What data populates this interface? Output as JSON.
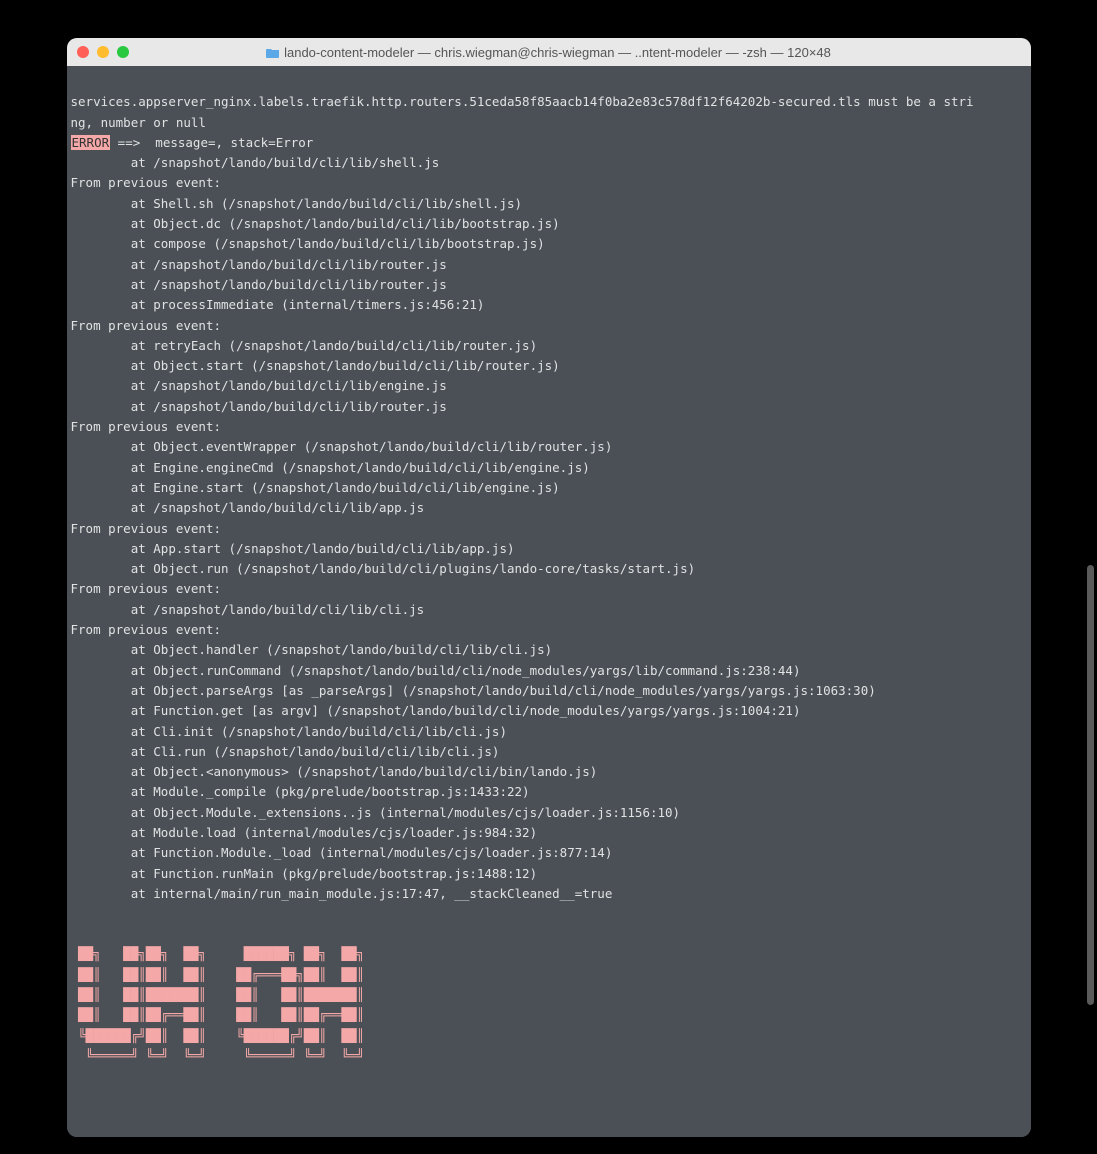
{
  "window": {
    "title": "lando-content-modeler — chris.wiegman@chris-wiegman — ..ntent-modeler — -zsh — 120×48"
  },
  "terminal": {
    "line1": "services.appserver_nginx.labels.traefik.http.routers.51ceda58f85aacb14f0ba2e83c578df12f64202b-secured.tls must be a stri",
    "line2": "ng, number or null",
    "error_label": "ERROR",
    "error_rest": " ==>  message=, stack=Error",
    "stack": [
      "        at /snapshot/lando/build/cli/lib/shell.js",
      "From previous event:",
      "        at Shell.sh (/snapshot/lando/build/cli/lib/shell.js)",
      "        at Object.dc (/snapshot/lando/build/cli/lib/bootstrap.js)",
      "        at compose (/snapshot/lando/build/cli/lib/bootstrap.js)",
      "        at /snapshot/lando/build/cli/lib/router.js",
      "        at /snapshot/lando/build/cli/lib/router.js",
      "        at processImmediate (internal/timers.js:456:21)",
      "From previous event:",
      "        at retryEach (/snapshot/lando/build/cli/lib/router.js)",
      "        at Object.start (/snapshot/lando/build/cli/lib/router.js)",
      "        at /snapshot/lando/build/cli/lib/engine.js",
      "        at /snapshot/lando/build/cli/lib/router.js",
      "From previous event:",
      "        at Object.eventWrapper (/snapshot/lando/build/cli/lib/router.js)",
      "        at Engine.engineCmd (/snapshot/lando/build/cli/lib/engine.js)",
      "        at Engine.start (/snapshot/lando/build/cli/lib/engine.js)",
      "        at /snapshot/lando/build/cli/lib/app.js",
      "From previous event:",
      "        at App.start (/snapshot/lando/build/cli/lib/app.js)",
      "        at Object.run (/snapshot/lando/build/cli/plugins/lando-core/tasks/start.js)",
      "From previous event:",
      "        at /snapshot/lando/build/cli/lib/cli.js",
      "From previous event:",
      "        at Object.handler (/snapshot/lando/build/cli/lib/cli.js)",
      "        at Object.runCommand (/snapshot/lando/build/cli/node_modules/yargs/lib/command.js:238:44)",
      "        at Object.parseArgs [as _parseArgs] (/snapshot/lando/build/cli/node_modules/yargs/yargs.js:1063:30)",
      "        at Function.get [as argv] (/snapshot/lando/build/cli/node_modules/yargs/yargs.js:1004:21)",
      "        at Cli.init (/snapshot/lando/build/cli/lib/cli.js)",
      "        at Cli.run (/snapshot/lando/build/cli/lib/cli.js)",
      "        at Object.<anonymous> (/snapshot/lando/build/cli/bin/lando.js)",
      "        at Module._compile (pkg/prelude/bootstrap.js:1433:22)",
      "        at Object.Module._extensions..js (internal/modules/cjs/loader.js:1156:10)",
      "        at Module.load (internal/modules/cjs/loader.js:984:32)",
      "        at Function.Module._load (internal/modules/cjs/loader.js:877:14)",
      "        at Function.runMain (pkg/prelude/bootstrap.js:1488:12)",
      "        at internal/main/run_main_module.js:17:47, __stackCleaned__=true"
    ],
    "ascii": [
      " ██╗   ██╗██╗  ██╗     ██████╗ ██╗  ██╗",
      " ██║   ██║██║  ██║    ██╔═══██╗██║  ██║",
      " ██║   ██║███████║    ██║   ██║███████║",
      " ██║   ██║██╔══██║    ██║   ██║██╔══██║",
      " ╚██████╔╝██║  ██║    ╚██████╔╝██║  ██║",
      "  ╚═════╝ ╚═╝  ╚═╝     ╚═════╝ ╚═╝  ╚═╝"
    ]
  }
}
